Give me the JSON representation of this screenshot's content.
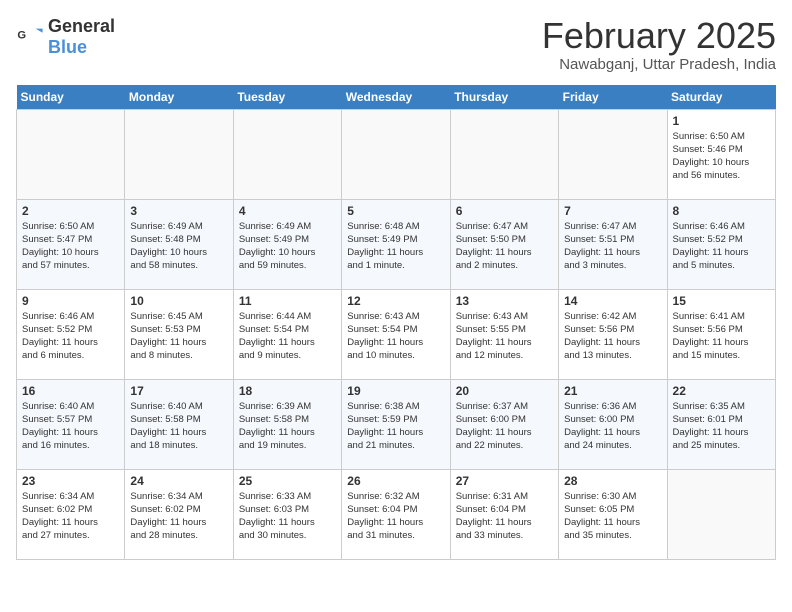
{
  "header": {
    "logo_general": "General",
    "logo_blue": "Blue",
    "title": "February 2025",
    "subtitle": "Nawabganj, Uttar Pradesh, India"
  },
  "weekdays": [
    "Sunday",
    "Monday",
    "Tuesday",
    "Wednesday",
    "Thursday",
    "Friday",
    "Saturday"
  ],
  "weeks": [
    [
      {
        "num": "",
        "info": ""
      },
      {
        "num": "",
        "info": ""
      },
      {
        "num": "",
        "info": ""
      },
      {
        "num": "",
        "info": ""
      },
      {
        "num": "",
        "info": ""
      },
      {
        "num": "",
        "info": ""
      },
      {
        "num": "1",
        "info": "Sunrise: 6:50 AM\nSunset: 5:46 PM\nDaylight: 10 hours\nand 56 minutes."
      }
    ],
    [
      {
        "num": "2",
        "info": "Sunrise: 6:50 AM\nSunset: 5:47 PM\nDaylight: 10 hours\nand 57 minutes."
      },
      {
        "num": "3",
        "info": "Sunrise: 6:49 AM\nSunset: 5:48 PM\nDaylight: 10 hours\nand 58 minutes."
      },
      {
        "num": "4",
        "info": "Sunrise: 6:49 AM\nSunset: 5:49 PM\nDaylight: 10 hours\nand 59 minutes."
      },
      {
        "num": "5",
        "info": "Sunrise: 6:48 AM\nSunset: 5:49 PM\nDaylight: 11 hours\nand 1 minute."
      },
      {
        "num": "6",
        "info": "Sunrise: 6:47 AM\nSunset: 5:50 PM\nDaylight: 11 hours\nand 2 minutes."
      },
      {
        "num": "7",
        "info": "Sunrise: 6:47 AM\nSunset: 5:51 PM\nDaylight: 11 hours\nand 3 minutes."
      },
      {
        "num": "8",
        "info": "Sunrise: 6:46 AM\nSunset: 5:52 PM\nDaylight: 11 hours\nand 5 minutes."
      }
    ],
    [
      {
        "num": "9",
        "info": "Sunrise: 6:46 AM\nSunset: 5:52 PM\nDaylight: 11 hours\nand 6 minutes."
      },
      {
        "num": "10",
        "info": "Sunrise: 6:45 AM\nSunset: 5:53 PM\nDaylight: 11 hours\nand 8 minutes."
      },
      {
        "num": "11",
        "info": "Sunrise: 6:44 AM\nSunset: 5:54 PM\nDaylight: 11 hours\nand 9 minutes."
      },
      {
        "num": "12",
        "info": "Sunrise: 6:43 AM\nSunset: 5:54 PM\nDaylight: 11 hours\nand 10 minutes."
      },
      {
        "num": "13",
        "info": "Sunrise: 6:43 AM\nSunset: 5:55 PM\nDaylight: 11 hours\nand 12 minutes."
      },
      {
        "num": "14",
        "info": "Sunrise: 6:42 AM\nSunset: 5:56 PM\nDaylight: 11 hours\nand 13 minutes."
      },
      {
        "num": "15",
        "info": "Sunrise: 6:41 AM\nSunset: 5:56 PM\nDaylight: 11 hours\nand 15 minutes."
      }
    ],
    [
      {
        "num": "16",
        "info": "Sunrise: 6:40 AM\nSunset: 5:57 PM\nDaylight: 11 hours\nand 16 minutes."
      },
      {
        "num": "17",
        "info": "Sunrise: 6:40 AM\nSunset: 5:58 PM\nDaylight: 11 hours\nand 18 minutes."
      },
      {
        "num": "18",
        "info": "Sunrise: 6:39 AM\nSunset: 5:58 PM\nDaylight: 11 hours\nand 19 minutes."
      },
      {
        "num": "19",
        "info": "Sunrise: 6:38 AM\nSunset: 5:59 PM\nDaylight: 11 hours\nand 21 minutes."
      },
      {
        "num": "20",
        "info": "Sunrise: 6:37 AM\nSunset: 6:00 PM\nDaylight: 11 hours\nand 22 minutes."
      },
      {
        "num": "21",
        "info": "Sunrise: 6:36 AM\nSunset: 6:00 PM\nDaylight: 11 hours\nand 24 minutes."
      },
      {
        "num": "22",
        "info": "Sunrise: 6:35 AM\nSunset: 6:01 PM\nDaylight: 11 hours\nand 25 minutes."
      }
    ],
    [
      {
        "num": "23",
        "info": "Sunrise: 6:34 AM\nSunset: 6:02 PM\nDaylight: 11 hours\nand 27 minutes."
      },
      {
        "num": "24",
        "info": "Sunrise: 6:34 AM\nSunset: 6:02 PM\nDaylight: 11 hours\nand 28 minutes."
      },
      {
        "num": "25",
        "info": "Sunrise: 6:33 AM\nSunset: 6:03 PM\nDaylight: 11 hours\nand 30 minutes."
      },
      {
        "num": "26",
        "info": "Sunrise: 6:32 AM\nSunset: 6:04 PM\nDaylight: 11 hours\nand 31 minutes."
      },
      {
        "num": "27",
        "info": "Sunrise: 6:31 AM\nSunset: 6:04 PM\nDaylight: 11 hours\nand 33 minutes."
      },
      {
        "num": "28",
        "info": "Sunrise: 6:30 AM\nSunset: 6:05 PM\nDaylight: 11 hours\nand 35 minutes."
      },
      {
        "num": "",
        "info": ""
      }
    ]
  ]
}
